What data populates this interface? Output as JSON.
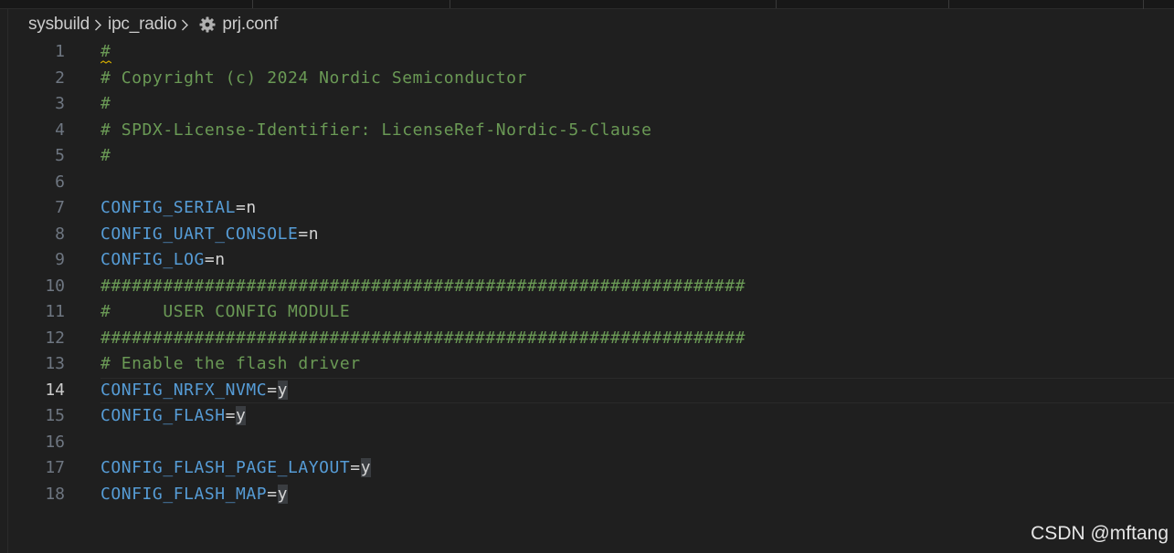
{
  "breadcrumb": {
    "folder1": "sysbuild",
    "folder2": "ipc_radio",
    "file": "prj.conf"
  },
  "colors": {
    "background": "#1f1f1f",
    "comment": "#6a9955",
    "key": "#569cd6",
    "text": "#d4d4d4",
    "line_number": "#6e7681",
    "selection_highlight": "#3a3d41"
  },
  "icons": {
    "file": "gear-icon",
    "separator": "chevron-right-icon"
  },
  "editor": {
    "current_line": 14,
    "lines": [
      {
        "num": "1",
        "comment": "#"
      },
      {
        "num": "2",
        "comment": "# Copyright (c) 2024 Nordic Semiconductor"
      },
      {
        "num": "3",
        "comment": "#"
      },
      {
        "num": "4",
        "comment": "# SPDX-License-Identifier: LicenseRef-Nordic-5-Clause"
      },
      {
        "num": "5",
        "comment": "#"
      },
      {
        "num": "6"
      },
      {
        "num": "7",
        "key": "CONFIG_SERIAL",
        "eq": "=",
        "val": "n"
      },
      {
        "num": "8",
        "key": "CONFIG_UART_CONSOLE",
        "eq": "=",
        "val": "n"
      },
      {
        "num": "9",
        "key": "CONFIG_LOG",
        "eq": "=",
        "val": "n"
      },
      {
        "num": "10",
        "comment": "##############################################################"
      },
      {
        "num": "11",
        "comment": "#     USER CONFIG MODULE"
      },
      {
        "num": "12",
        "comment": "##############################################################"
      },
      {
        "num": "13",
        "comment": "# Enable the flash driver"
      },
      {
        "num": "14",
        "key": "CONFIG_NRFX_NVMC",
        "eq": "=",
        "val": "y"
      },
      {
        "num": "15",
        "key": "CONFIG_FLASH",
        "eq": "=",
        "val": "y"
      },
      {
        "num": "16"
      },
      {
        "num": "17",
        "key": "CONFIG_FLASH_PAGE_LAYOUT",
        "eq": "=",
        "val": "y"
      },
      {
        "num": "18",
        "key": "CONFIG_FLASH_MAP",
        "eq": "=",
        "val": "y"
      }
    ]
  },
  "watermark": "CSDN @mftang"
}
